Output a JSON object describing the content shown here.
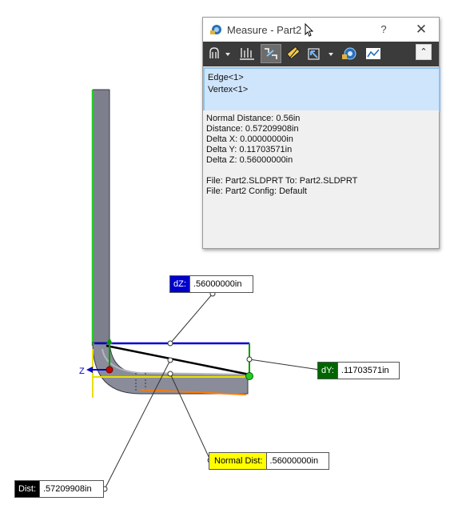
{
  "window": {
    "title": "Measure - Part2",
    "help_label": "?",
    "close_label": "✕",
    "collapse_label": "⌃"
  },
  "toolbar": {
    "icons": [
      "arc-circle-measure-icon",
      "units-precision-icon",
      "show-xyz-icon",
      "point-to-point-icon",
      "projection-icon",
      "sensor-icon",
      "history-icon"
    ]
  },
  "selections": [
    "Edge<1>",
    "Vertex<1>"
  ],
  "results": [
    "Normal Distance: 0.56in",
    "Distance: 0.57209908in",
    "Delta X: 0.00000000in",
    "Delta Y: 0.11703571in",
    "Delta Z: 0.56000000in",
    "",
    "File: Part2.SLDPRT To: Part2.SLDPRT",
    "File: Part2 Config: Default"
  ],
  "callouts": {
    "dz": {
      "label": "dZ:",
      "value": ".56000000in",
      "color": "#0000cc"
    },
    "dy": {
      "label": "dY:",
      "value": ".11703571in",
      "color": "#006600"
    },
    "normal": {
      "label": "Normal Dist:",
      "value": ".56000000in",
      "color": "#ffff00"
    },
    "dist": {
      "label": "Dist:",
      "value": ".57209908in",
      "color": "#000000"
    }
  },
  "axis": {
    "z_label": "Z"
  }
}
